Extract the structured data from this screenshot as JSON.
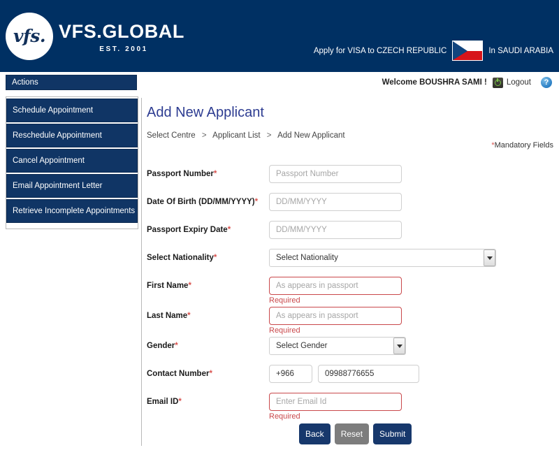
{
  "header": {
    "logo_mark": "vfs.",
    "brand_name": "VFS.GLOBAL",
    "brand_est": "EST. 2001",
    "apply_text": "Apply for VISA to CZECH REPUBLIC",
    "country_text": "In SAUDI ARABIA",
    "flag_name": "czech-republic-flag",
    "brand_navy": "#003063"
  },
  "welcome": {
    "greeting": "Welcome BOUSHRA SAMI !",
    "logout_label": "Logout",
    "help_label": "?"
  },
  "sidebar": {
    "header_label": "Actions",
    "items": [
      {
        "label": "Schedule Appointment"
      },
      {
        "label": "Reschedule Appointment"
      },
      {
        "label": "Cancel Appointment"
      },
      {
        "label": "Email Appointment Letter"
      },
      {
        "label": "Retrieve Incomplete Appointments"
      }
    ]
  },
  "main": {
    "title": "Add New Applicant",
    "breadcrumb": [
      {
        "label": "Select Centre"
      },
      {
        "label": "Applicant List"
      },
      {
        "label": "Add New Applicant"
      }
    ],
    "breadcrumb_separator": ">",
    "mandatory_note": "Mandatory Fields",
    "mandatory_star": "*"
  },
  "form": {
    "required_marker": "*",
    "passport_number": {
      "label": "Passport Number",
      "placeholder": "Passport Number",
      "value": ""
    },
    "date_of_birth": {
      "label": "Date Of Birth (DD/MM/YYYY)",
      "placeholder": "DD/MM/YYYY",
      "value": ""
    },
    "passport_expiry": {
      "label": "Passport Expiry Date",
      "placeholder": "DD/MM/YYYY",
      "value": ""
    },
    "nationality": {
      "label": "Select Nationality",
      "selected": "Select Nationality"
    },
    "first_name": {
      "label": "First Name",
      "placeholder": "As appears in passport",
      "value": "",
      "error": "Required"
    },
    "last_name": {
      "label": "Last Name",
      "placeholder": "As appears in passport",
      "value": "",
      "error": "Required"
    },
    "gender": {
      "label": "Gender",
      "selected": "Select Gender"
    },
    "contact_number": {
      "label": "Contact Number",
      "country_code": "+966",
      "value": "09988776655"
    },
    "email": {
      "label": "Email ID",
      "placeholder": "Enter Email Id",
      "value": "",
      "error": "Required"
    }
  },
  "buttons": {
    "back": "Back",
    "reset": "Reset",
    "submit": "Submit"
  }
}
